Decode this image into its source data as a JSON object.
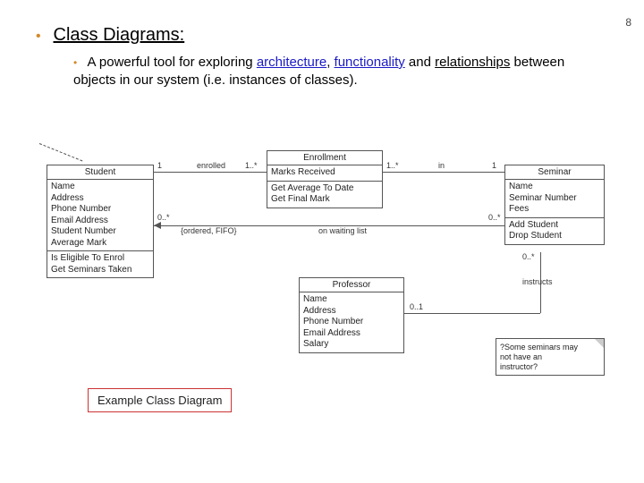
{
  "page": {
    "number": "8"
  },
  "heading": {
    "text": "Class Diagrams:"
  },
  "subbullet": {
    "prefix": "A powerful tool for exploring ",
    "w1": "architecture",
    "sep1": ", ",
    "w2": "functionality",
    "mid": " and ",
    "w3": "relationships",
    "suffix": " between objects in our system (i.e. instances of classes)."
  },
  "student": {
    "title": "Student",
    "attrs": "Name\nAddress\nPhone Number\nEmail Address\nStudent Number\nAverage Mark",
    "ops": "Is Eligible To Enrol\nGet Seminars Taken"
  },
  "enrollment": {
    "title": "Enrollment",
    "attrs": "Marks Received",
    "ops": "Get Average To Date\nGet Final Mark"
  },
  "seminar": {
    "title": "Seminar",
    "attrs": "Name\nSeminar Number\nFees",
    "ops": "Add Student\nDrop Student"
  },
  "professor": {
    "title": "Professor",
    "attrs": "Name\nAddress\nPhone Number\nEmail Address\nSalary"
  },
  "assoc": {
    "stu_enr_label": "enrolled",
    "stu_enr_l": "1",
    "stu_enr_r": "1..*",
    "enr_sem_label": "in",
    "enr_sem_l": "1..*",
    "enr_sem_r": "1",
    "wait_label": "on waiting list",
    "wait_sorted": "{ordered, FIFO}",
    "wait_l": "0..*",
    "wait_r": "0..*",
    "instr_label": "instructs",
    "instr_l": "0..1",
    "instr_r": "0..*"
  },
  "note": {
    "text": "?Some seminars may\nnot have an\ninstructor?"
  },
  "caption": {
    "text": "Example Class Diagram"
  }
}
